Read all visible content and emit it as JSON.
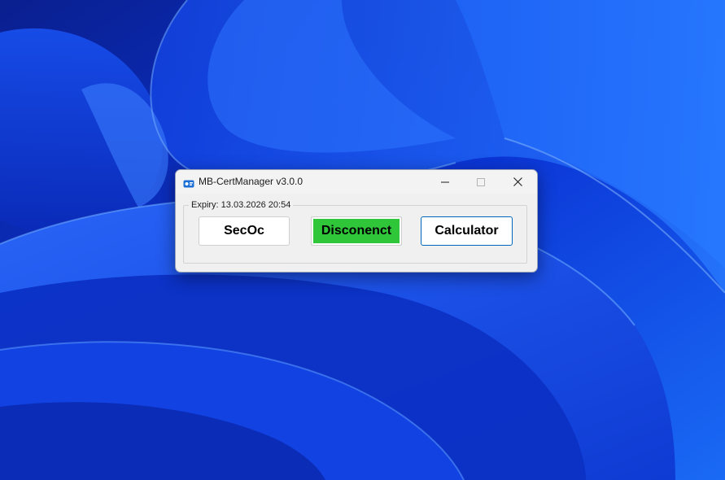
{
  "colors": {
    "desktop_bg": "#0a2fc8",
    "window_bg": "#f0f0f0",
    "disconnect_bg": "#2fc63a",
    "calculator_border": "#0067c0"
  },
  "window": {
    "title": "MB-CertManager v3.0.0",
    "icon": "app-icon",
    "controls": {
      "minimize_icon": "minimize-icon",
      "maximize_icon": "maximize-icon",
      "close_icon": "close-icon"
    },
    "group": {
      "label": "Expiry: 13.03.2026 20:54"
    },
    "buttons": {
      "secoc_label": "SecOc",
      "disconnect_label": "Disconenct",
      "calculator_label": "Calculator"
    }
  }
}
